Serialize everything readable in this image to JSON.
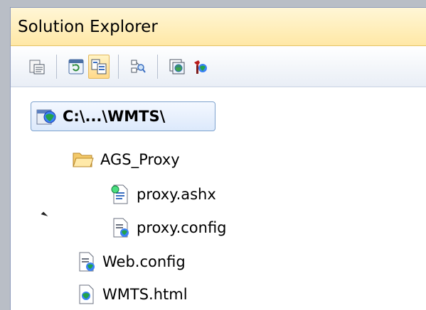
{
  "panel": {
    "title": "Solution Explorer"
  },
  "toolbar": {
    "buttons": [
      {
        "icon": "properties-icon"
      },
      {
        "icon": "refresh-icon"
      },
      {
        "icon": "show-all-files-icon",
        "active": true
      },
      {
        "icon": "view-class-diagram-icon"
      },
      {
        "icon": "view-in-browser-icon"
      },
      {
        "icon": "asp-net-configuration-icon"
      }
    ]
  },
  "tree": {
    "root": {
      "label": "C:\\...\\WMTS\\",
      "icon": "website-globe-icon",
      "selected": true
    },
    "items": [
      {
        "label": "AGS_Proxy",
        "icon": "folder-open-icon",
        "expanded": true
      },
      {
        "label": "proxy.ashx",
        "icon": "handler-file-icon"
      },
      {
        "label": "proxy.config",
        "icon": "config-file-icon"
      },
      {
        "label": "Web.config",
        "icon": "config-file-icon"
      },
      {
        "label": "WMTS.html",
        "icon": "html-file-icon"
      }
    ]
  }
}
